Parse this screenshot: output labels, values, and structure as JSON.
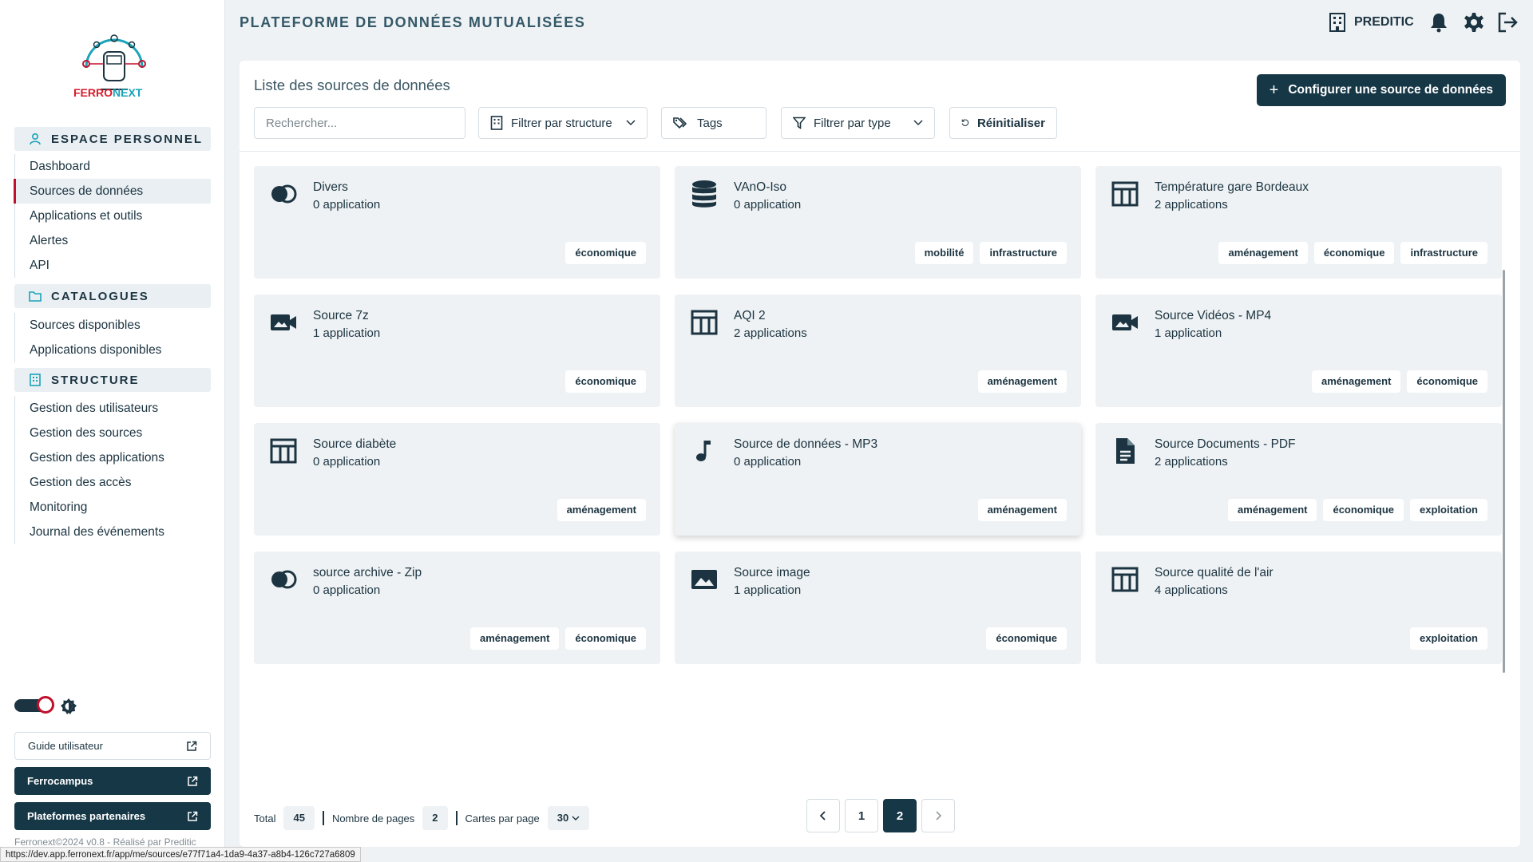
{
  "brand": {
    "logo_text_a": "FERRO",
    "logo_text_b": "NEXT"
  },
  "header": {
    "title": "PLATEFORME DE DONNÉES MUTUALISÉES",
    "org": "PREDITIC"
  },
  "sidebar": {
    "sections": [
      {
        "title": "ESPACE PERSONNEL",
        "icon": "user-icon",
        "items": [
          "Dashboard",
          "Sources de données",
          "Applications et outils",
          "Alertes",
          "API"
        ]
      },
      {
        "title": "CATALOGUES",
        "icon": "folder-icon",
        "items": [
          "Sources disponibles",
          "Applications disponibles"
        ]
      },
      {
        "title": "STRUCTURE",
        "icon": "building-icon",
        "items": [
          "Gestion des utilisateurs",
          "Gestion des sources",
          "Gestion des applications",
          "Gestion des accès",
          "Monitoring",
          "Journal des événements"
        ]
      }
    ],
    "active_item": "Sources de données",
    "guide": "Guide utilisateur",
    "ferrocampus": "Ferrocampus",
    "partners": "Plateformes partenaires",
    "footer": "Ferronext©2024 v0.8 - Réalisé par Preditic",
    "status_url": "https://dev.app.ferronext.fr/app/me/sources/e77f71a4-1da9-4a37-a8b4-126c727a6809"
  },
  "main": {
    "list_title": "Liste des sources de données",
    "configure_button": "Configurer une source de données",
    "search_placeholder": "Rechercher...",
    "filter_structure": "Filtrer par structure",
    "tags": "Tags",
    "filter_type": "Filtrer par type",
    "reset": "Réinitialiser"
  },
  "cards": [
    {
      "title": "Divers",
      "sub": "0 application",
      "icon": "circles-icon",
      "tags": [
        "économique"
      ]
    },
    {
      "title": "VAnO-Iso",
      "sub": "0 application",
      "icon": "database-icon",
      "tags": [
        "mobilité",
        "infrastructure"
      ]
    },
    {
      "title": "Température gare Bordeaux",
      "sub": "2 applications",
      "icon": "table-icon",
      "tags": [
        "aménagement",
        "économique",
        "infrastructure"
      ]
    },
    {
      "title": "Source 7z",
      "sub": "1 application",
      "icon": "video-icon",
      "tags": [
        "économique"
      ]
    },
    {
      "title": "AQI 2",
      "sub": "2 applications",
      "icon": "table-icon",
      "tags": [
        "aménagement"
      ]
    },
    {
      "title": "Source Vidéos - MP4",
      "sub": "1 application",
      "icon": "video-icon",
      "tags": [
        "aménagement",
        "économique"
      ]
    },
    {
      "title": "Source diabète",
      "sub": "0 application",
      "icon": "table-icon",
      "tags": [
        "aménagement"
      ]
    },
    {
      "title": "Source de données - MP3",
      "sub": "0 application",
      "icon": "music-icon",
      "tags": [
        "aménagement"
      ]
    },
    {
      "title": "Source Documents - PDF",
      "sub": "2 applications",
      "icon": "document-icon",
      "tags": [
        "aménagement",
        "économique",
        "exploitation"
      ]
    },
    {
      "title": "source archive - Zip",
      "sub": "0 application",
      "icon": "circles-icon",
      "tags": [
        "aménagement",
        "économique"
      ]
    },
    {
      "title": "Source image",
      "sub": "1 application",
      "icon": "image-icon",
      "tags": [
        "économique"
      ]
    },
    {
      "title": "Source qualité de l'air",
      "sub": "4 applications",
      "icon": "table-icon",
      "tags": [
        "exploitation"
      ]
    }
  ],
  "footer_bar": {
    "total_label": "Total",
    "total": "45",
    "pages_label": "Nombre de pages",
    "pages": "2",
    "per_page_label": "Cartes par page",
    "per_page": "30"
  },
  "pagination": {
    "pages": [
      "1",
      "2"
    ],
    "current": "2"
  },
  "colors": {
    "primary": "#163746",
    "accent_red": "#c0102b",
    "accent_teal": "#1aa3b8",
    "card_bg": "#eef2f4"
  }
}
